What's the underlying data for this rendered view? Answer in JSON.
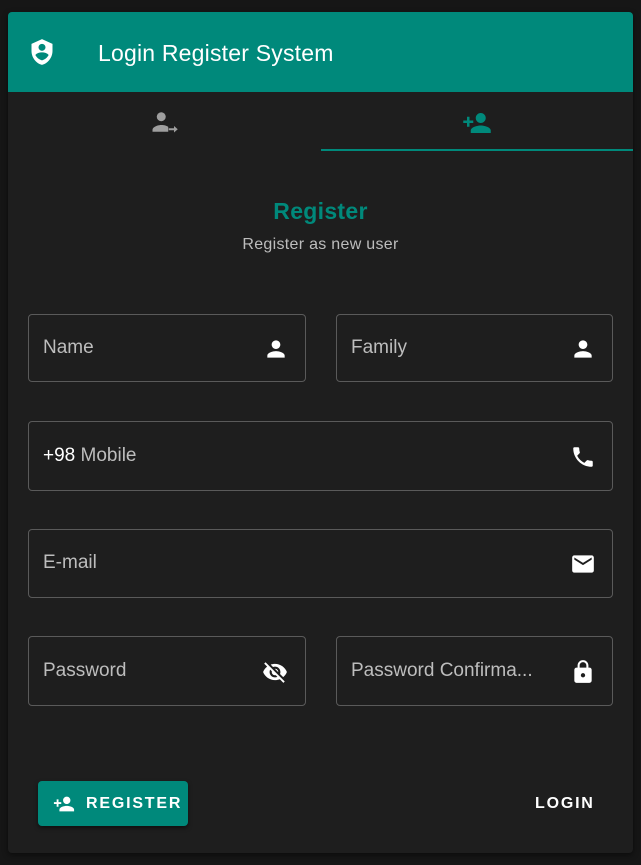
{
  "app": {
    "title": "Login Register System",
    "icon": "shield-account-icon",
    "colors": {
      "primary": "#00897b",
      "surface": "#1e1e1e",
      "background": "#161616",
      "text": "#ffffff",
      "muted": "#bdbdbd"
    }
  },
  "tabs": [
    {
      "icon": "login-user-icon",
      "active": false
    },
    {
      "icon": "account-plus-icon",
      "active": true
    }
  ],
  "form": {
    "title": "Register",
    "subtitle": "Register as new user",
    "fields": {
      "name": {
        "placeholder": "Name",
        "icon": "person-icon"
      },
      "family": {
        "placeholder": "Family",
        "icon": "person-icon"
      },
      "mobile": {
        "prefix": "+98",
        "placeholder": "Mobile",
        "icon": "phone-icon"
      },
      "email": {
        "placeholder": "E-mail",
        "icon": "mail-icon"
      },
      "password": {
        "placeholder": "Password",
        "icon": "visibility-off-icon"
      },
      "password_confirm": {
        "placeholder": "Password Confirma...",
        "icon": "lock-icon"
      }
    }
  },
  "actions": {
    "register_label": "REGISTER",
    "login_label": "LOGIN"
  }
}
